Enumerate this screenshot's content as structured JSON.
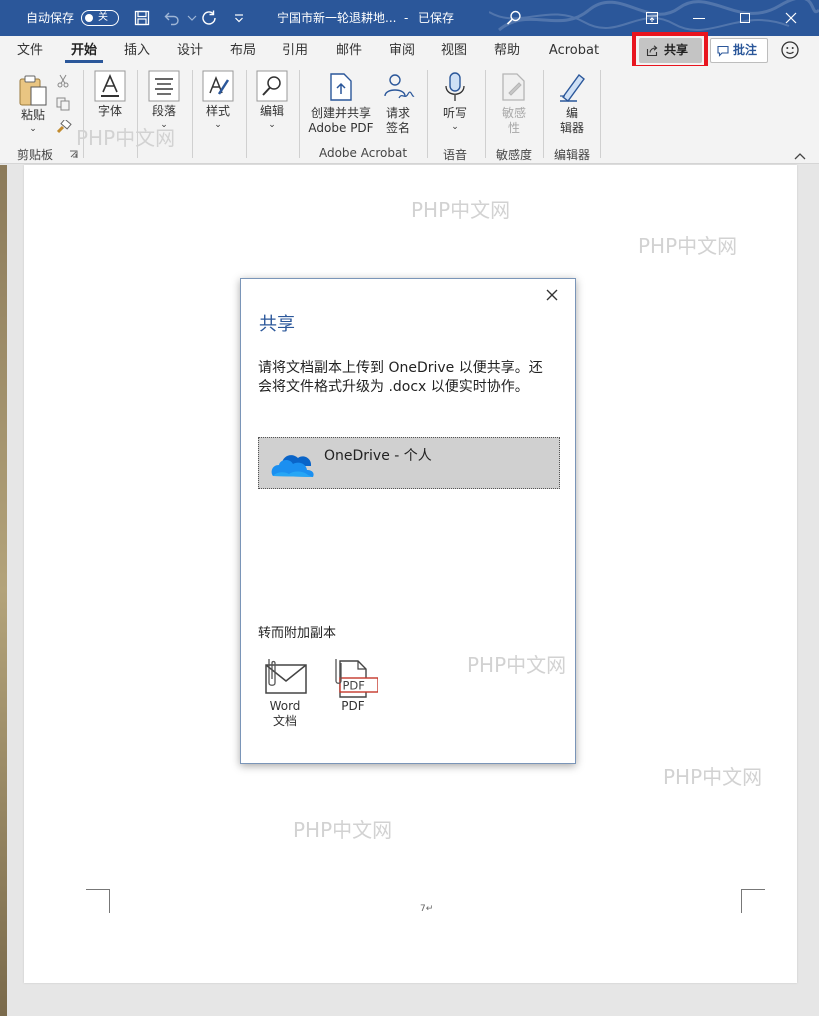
{
  "titlebar": {
    "autosave_label": "自动保存",
    "autosave_state": "关",
    "document_title": "宁国市新一轮退耕地...",
    "save_status": "已保存",
    "bg_color": "#2b579a"
  },
  "ribbon_tabs": [
    "文件",
    "开始",
    "插入",
    "设计",
    "布局",
    "引用",
    "邮件",
    "审阅",
    "视图",
    "帮助",
    "Acrobat"
  ],
  "active_tab": "开始",
  "header_buttons": {
    "share_label": "共享",
    "comment_label": "批注"
  },
  "ribbon": {
    "paste_label": "粘贴",
    "clipboard_group": "剪贴板",
    "font_label": "字体",
    "paragraph_label": "段落",
    "styles_label": "样式",
    "editing_label": "编辑",
    "create_share_pdf_line1": "创建并共享",
    "create_share_pdf_line2": "Adobe PDF",
    "request_sign_line1": "请求",
    "request_sign_line2": "签名",
    "acrobat_group": "Adobe Acrobat",
    "dictate_label": "听写",
    "voice_group": "语音",
    "sensitivity_line1": "敏感",
    "sensitivity_line2": "性",
    "sensitivity_group": "敏感度",
    "editor_line1": "编",
    "editor_line2": "辑器",
    "editor_group": "编辑器"
  },
  "document": {
    "page_number": "7↵"
  },
  "watermarks": [
    "PHP中文网",
    "PHP中文网",
    "PHP中文网",
    "PHP中文网",
    "PHP中文网",
    "PHP中文网"
  ],
  "dialog": {
    "title": "共享",
    "description": "请将文档副本上传到 OneDrive 以便共享。还会将文件格式升级为 .docx 以便实时协作。",
    "onedrive_label": "OneDrive - 个人",
    "attach_heading": "转而附加副本",
    "attach_word_line1": "Word",
    "attach_word_line2": "文档",
    "attach_pdf_label": "PDF"
  },
  "colors": {
    "accent": "#2b579a",
    "highlight_box": "#e8141e",
    "onedrive_blue": "#0a64c8"
  }
}
